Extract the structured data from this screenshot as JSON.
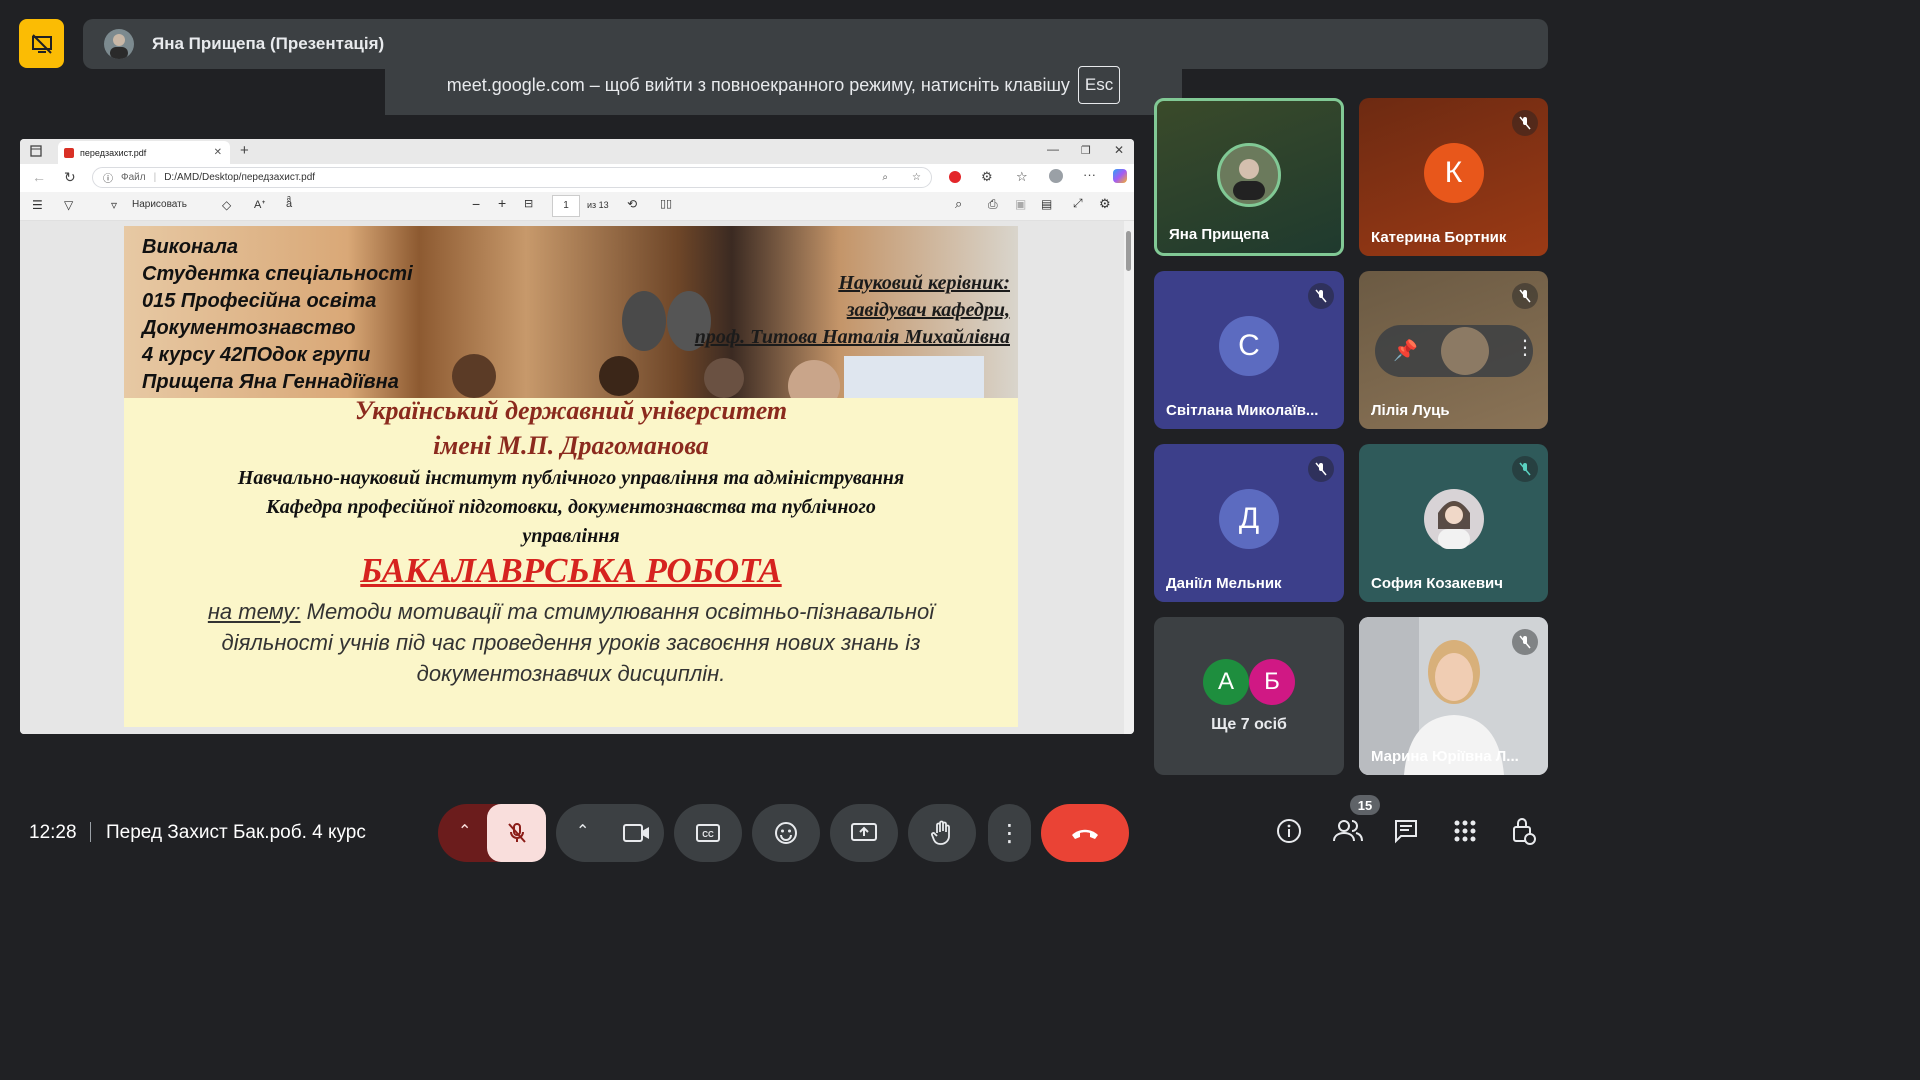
{
  "presenter": {
    "name": "Яна Прищепа (Презентація)"
  },
  "fullscreen_notice": {
    "text": "meet.google.com – щоб вийти з повноекранного режиму, натисніть клавішу",
    "key": "Esc"
  },
  "browser": {
    "tab_title": "передзахист.pdf",
    "url_label": "Файл",
    "url": "D:/AMD/Desktop/передзахист.pdf",
    "draw_label": "Нарисовать",
    "page_current": "1",
    "page_total": "из 13"
  },
  "slide": {
    "performer_lines": [
      "Виконала",
      "Студентка  спеціальності",
      "015 Професійна освіта",
      "Документознавство",
      "4 курсу 42ПОдок групи",
      "Прищепа Яна Геннадіївна"
    ],
    "supervisor_lines": [
      "Науковий керівник:",
      "завідувач кафедри,",
      "проф. Титова Наталія Михайлівна"
    ],
    "university_line1": "Український державний університет",
    "university_line2": "імені М.П. Драгоманова",
    "institute": "Навчально-науковий інститут публічного управління та адміністрування",
    "department_line1": "Кафедра професійної підготовки, документознавства та публічного",
    "department_line2": "управління",
    "thesis_title": "БАКАЛАВРСЬКА РОБОТА",
    "topic_label": "на тему:",
    "topic_line1": "Методи мотивації та  стимулювання освітньо-пізнавальної",
    "topic_line2": "діяльності учнів під час проведення уроків засвоєння нових знань із",
    "topic_line3": "документознавчих дисциплін."
  },
  "participants": [
    {
      "name": "Яна Прищепа",
      "muted": false,
      "active": true
    },
    {
      "name": "Катерина Бортник",
      "initial": "К",
      "color": "#e8571b",
      "muted": true
    },
    {
      "name": "Світлана Миколаїв...",
      "initial": "С",
      "color": "#5c6bc0",
      "muted": true
    },
    {
      "name": "Лілія Луць",
      "muted": true
    },
    {
      "name": "Даніїл Мельник",
      "initial": "Д",
      "color": "#5c6bc0",
      "muted": true
    },
    {
      "name": "София Козакевич",
      "muted": true
    },
    {
      "name": "Марина Юріївна Л...",
      "muted": true
    }
  ],
  "more_people": {
    "initials": [
      "А",
      "Б"
    ],
    "label": "Ще 7 осіб"
  },
  "bottom": {
    "time": "12:28",
    "meeting_title": "Перед Захист Бак.роб. 4 курс",
    "people_count": "15"
  },
  "colors": {
    "background": "#202124",
    "tile_grey": "#3c4043",
    "end_call": "#ea4335",
    "mic_off_bg": "#f9dedc",
    "active_border": "#81c995"
  }
}
